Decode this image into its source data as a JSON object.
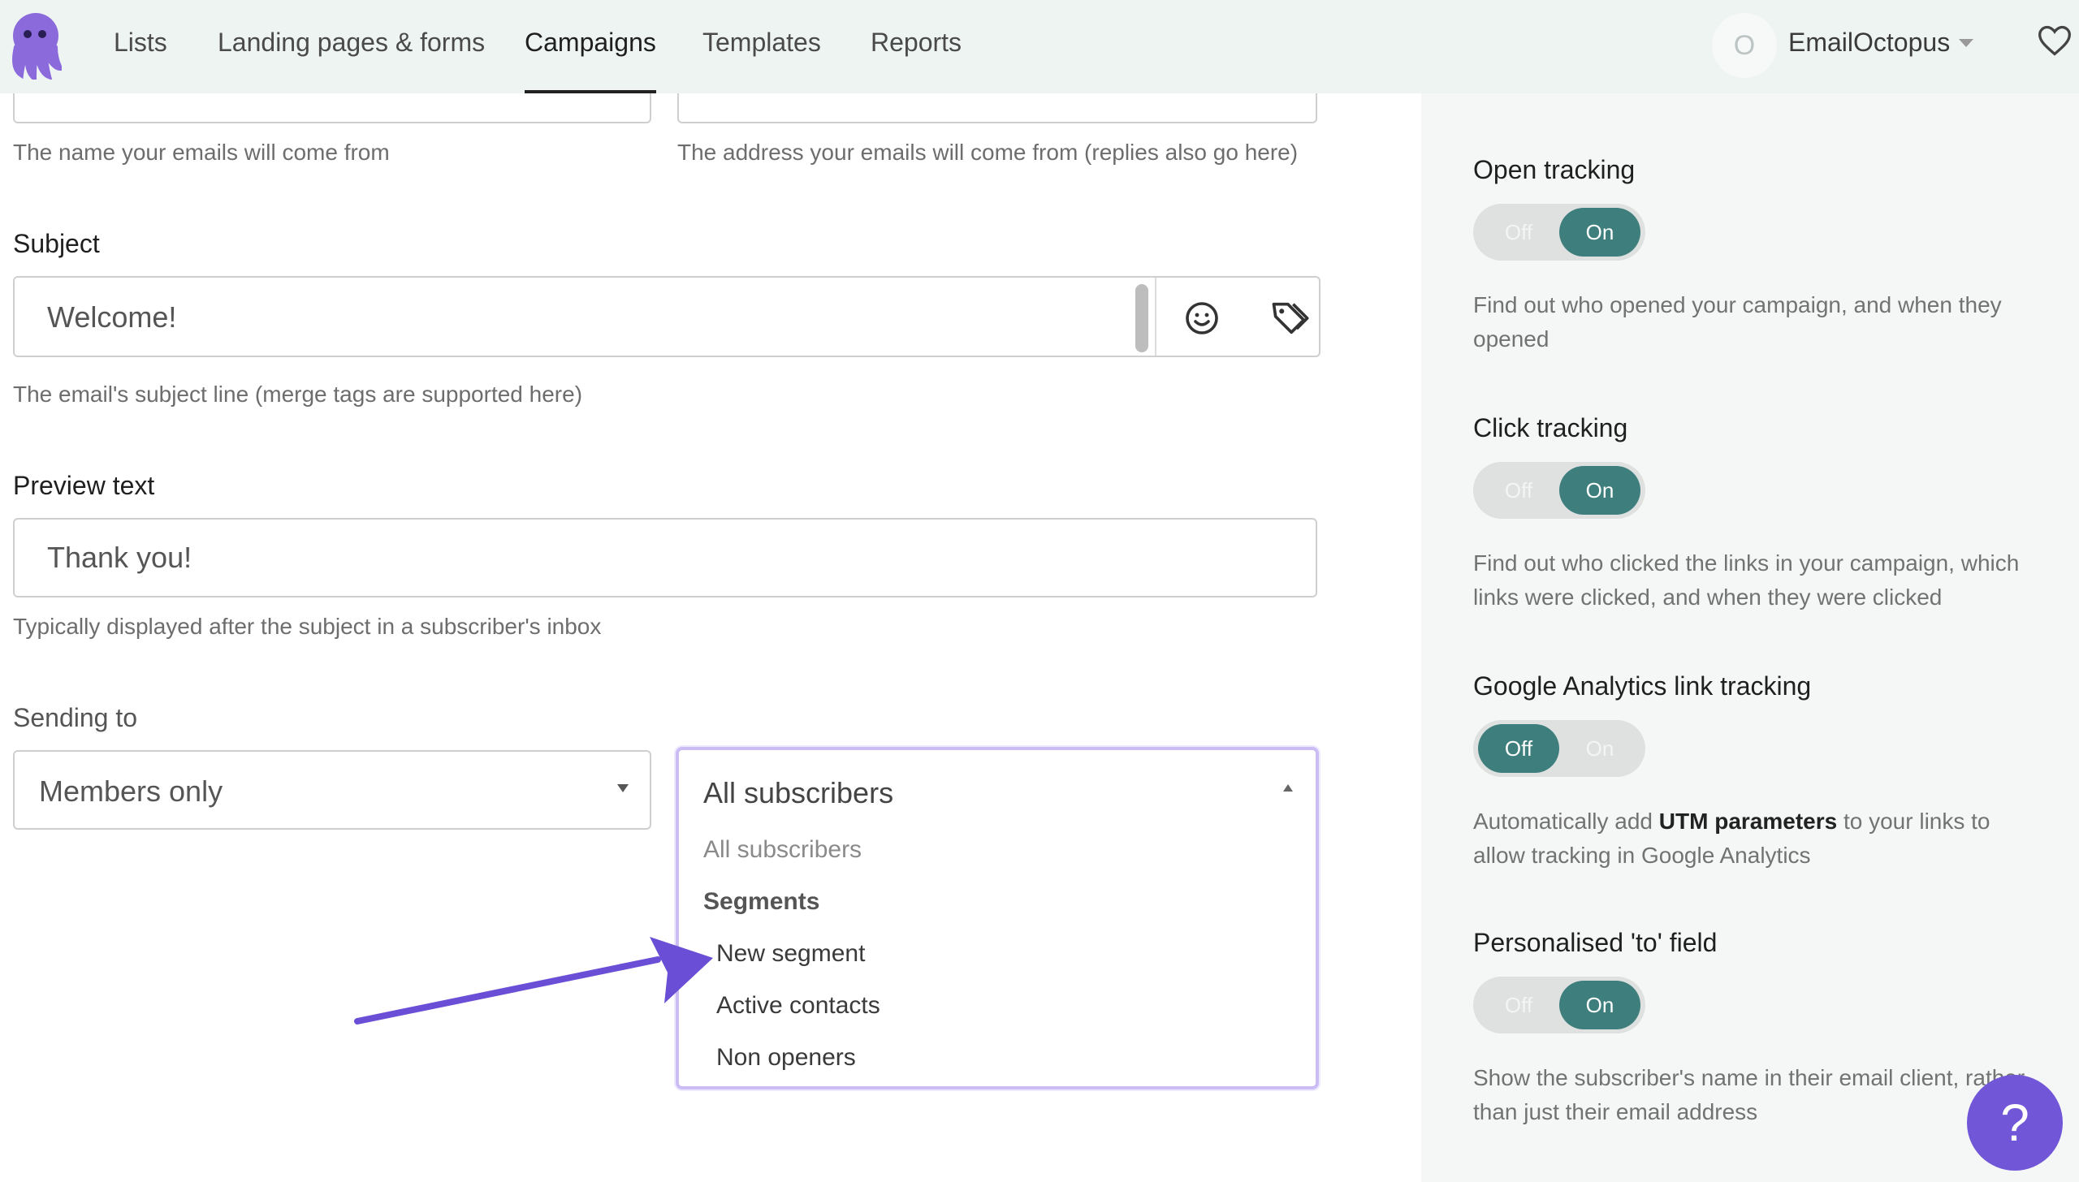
{
  "nav": {
    "items": [
      "Lists",
      "Landing pages & forms",
      "Campaigns",
      "Templates",
      "Reports"
    ],
    "active": "Campaigns",
    "account_initial": "O",
    "account_name": "EmailOctopus"
  },
  "form": {
    "from_name_helper": "The name your emails will come from",
    "from_email_helper": "The address your emails will come from (replies also go here)",
    "subject_label": "Subject",
    "subject_value": "Welcome!",
    "subject_helper": "The email's subject line (merge tags are supported here)",
    "preview_label": "Preview text",
    "preview_value": "Thank you!",
    "preview_helper": "Typically displayed after the subject in a subscriber's inbox",
    "sending_label": "Sending to",
    "sending_value": "Members only",
    "segment_selected": "All subscribers",
    "segment_options": {
      "all": "All subscribers",
      "group_label": "Segments",
      "items": [
        "New segment",
        "Active contacts",
        "Non openers"
      ]
    }
  },
  "settings": {
    "toggle_off": "Off",
    "toggle_on": "On",
    "items": [
      {
        "label": "Open tracking",
        "state": "on",
        "desc": "Find out who opened your campaign, and when they opened"
      },
      {
        "label": "Click tracking",
        "state": "on",
        "desc": "Find out who clicked the links in your campaign, which links were clicked, and when they were clicked"
      },
      {
        "label": "Google Analytics link tracking",
        "state": "off",
        "desc_pre": "Automatically add ",
        "desc_strong": "UTM parameters",
        "desc_post": " to your links to allow tracking in Google Analytics"
      },
      {
        "label": "Personalised 'to' field",
        "state": "on",
        "desc": "Show the subscriber's name in their email client, rather than just their email address"
      }
    ]
  },
  "help_button": "?",
  "colors": {
    "accent": "#3e7f7d",
    "brand": "#7156d8",
    "nav_bg": "#edf4f2"
  }
}
